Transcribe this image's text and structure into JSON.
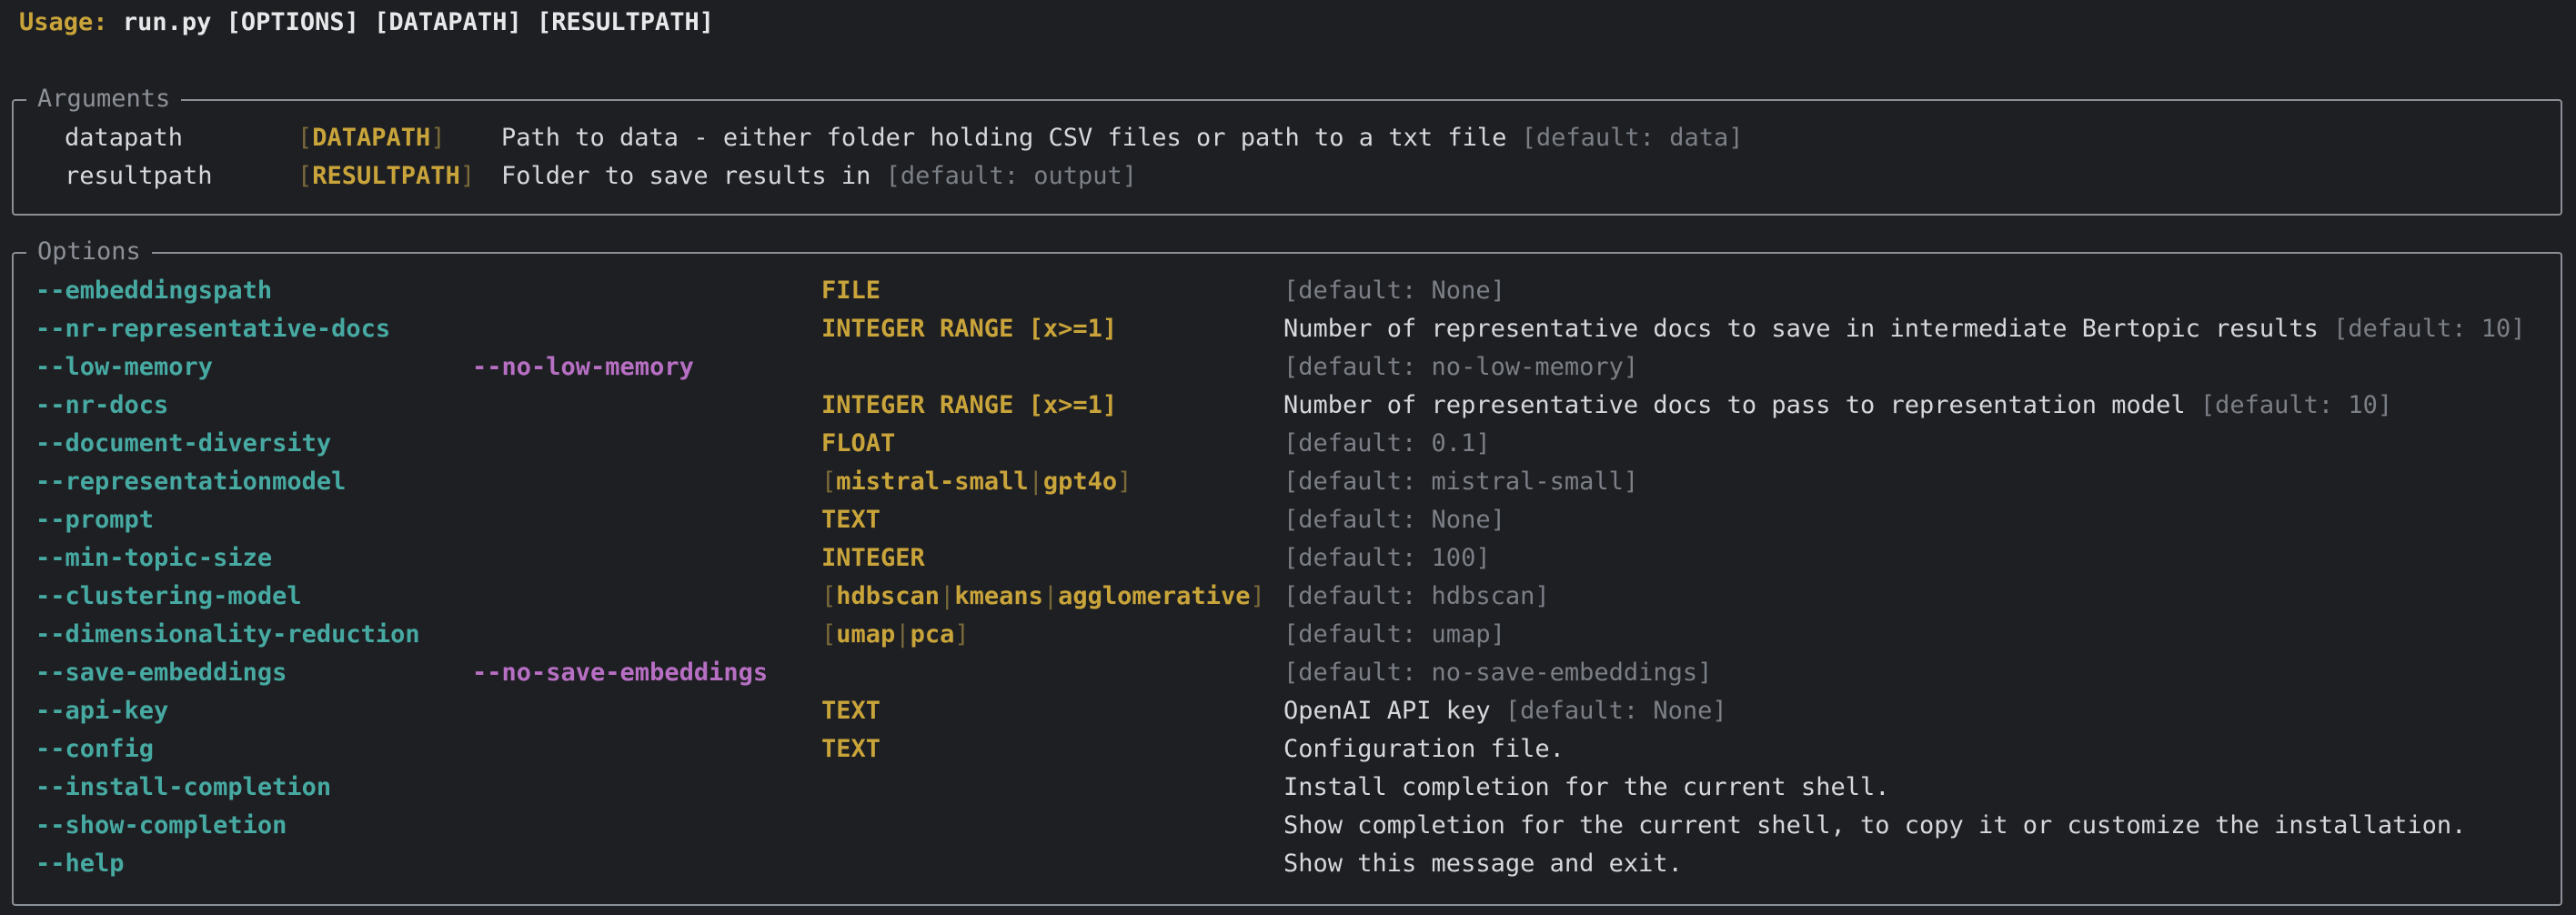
{
  "usage": {
    "label": "Usage:",
    "text": "run.py [OPTIONS] [DATAPATH] [RESULTPATH]"
  },
  "arguments_panel": {
    "title": "Arguments",
    "rows": [
      {
        "name": "datapath",
        "metavar": "DATAPATH",
        "description": "Path to data - either folder holding CSV files or path to a txt file",
        "default": "[default: data]"
      },
      {
        "name": "resultpath",
        "metavar": "RESULTPATH",
        "description": "Folder to save results in",
        "default": "[default: output]"
      }
    ]
  },
  "options_panel": {
    "title": "Options",
    "rows": [
      {
        "option": "--embeddingspath",
        "negation": "",
        "type": "FILE",
        "choices": [],
        "description": "",
        "default": "[default: None]"
      },
      {
        "option": "--nr-representative-docs",
        "negation": "",
        "type": "INTEGER RANGE [x>=1]",
        "choices": [],
        "description": "Number of representative docs to save in intermediate Bertopic results",
        "default": "[default: 10]"
      },
      {
        "option": "--low-memory",
        "negation": "--no-low-memory",
        "type": "",
        "choices": [],
        "description": "",
        "default": "[default: no-low-memory]"
      },
      {
        "option": "--nr-docs",
        "negation": "",
        "type": "INTEGER RANGE [x>=1]",
        "choices": [],
        "description": "Number of representative docs to pass to representation model",
        "default": "[default: 10]"
      },
      {
        "option": "--document-diversity",
        "negation": "",
        "type": "FLOAT",
        "choices": [],
        "description": "",
        "default": "[default: 0.1]"
      },
      {
        "option": "--representationmodel",
        "negation": "",
        "type": "",
        "choices": [
          "mistral-small",
          "gpt4o"
        ],
        "description": "",
        "default": "[default: mistral-small]"
      },
      {
        "option": "--prompt",
        "negation": "",
        "type": "TEXT",
        "choices": [],
        "description": "",
        "default": "[default: None]"
      },
      {
        "option": "--min-topic-size",
        "negation": "",
        "type": "INTEGER",
        "choices": [],
        "description": "",
        "default": "[default: 100]"
      },
      {
        "option": "--clustering-model",
        "negation": "",
        "type": "",
        "choices": [
          "hdbscan",
          "kmeans",
          "agglomerative"
        ],
        "description": "",
        "default": "[default: hdbscan]"
      },
      {
        "option": "--dimensionality-reduction",
        "negation": "",
        "type": "",
        "choices": [
          "umap",
          "pca"
        ],
        "description": "",
        "default": "[default: umap]"
      },
      {
        "option": "--save-embeddings",
        "negation": "--no-save-embeddings",
        "type": "",
        "choices": [],
        "description": "",
        "default": "[default: no-save-embeddings]"
      },
      {
        "option": "--api-key",
        "negation": "",
        "type": "TEXT",
        "choices": [],
        "description": "OpenAI API key",
        "default": "[default: None]"
      },
      {
        "option": "--config",
        "negation": "",
        "type": "TEXT",
        "choices": [],
        "description": "Configuration file.",
        "default": ""
      },
      {
        "option": "--install-completion",
        "negation": "",
        "type": "",
        "choices": [],
        "description": "Install completion for the current shell.",
        "default": ""
      },
      {
        "option": "--show-completion",
        "negation": "",
        "type": "",
        "choices": [],
        "description": "Show completion for the current shell, to copy it or customize the installation.",
        "default": ""
      },
      {
        "option": "--help",
        "negation": "",
        "type": "",
        "choices": [],
        "description": "Show this message and exit.",
        "default": ""
      }
    ]
  },
  "colors": {
    "background": "#1e1f22",
    "option": "#46a9a2",
    "negation": "#b76fc4",
    "metavar": "#c9a43a",
    "default": "#7b7f86",
    "border": "#8b8f96"
  }
}
